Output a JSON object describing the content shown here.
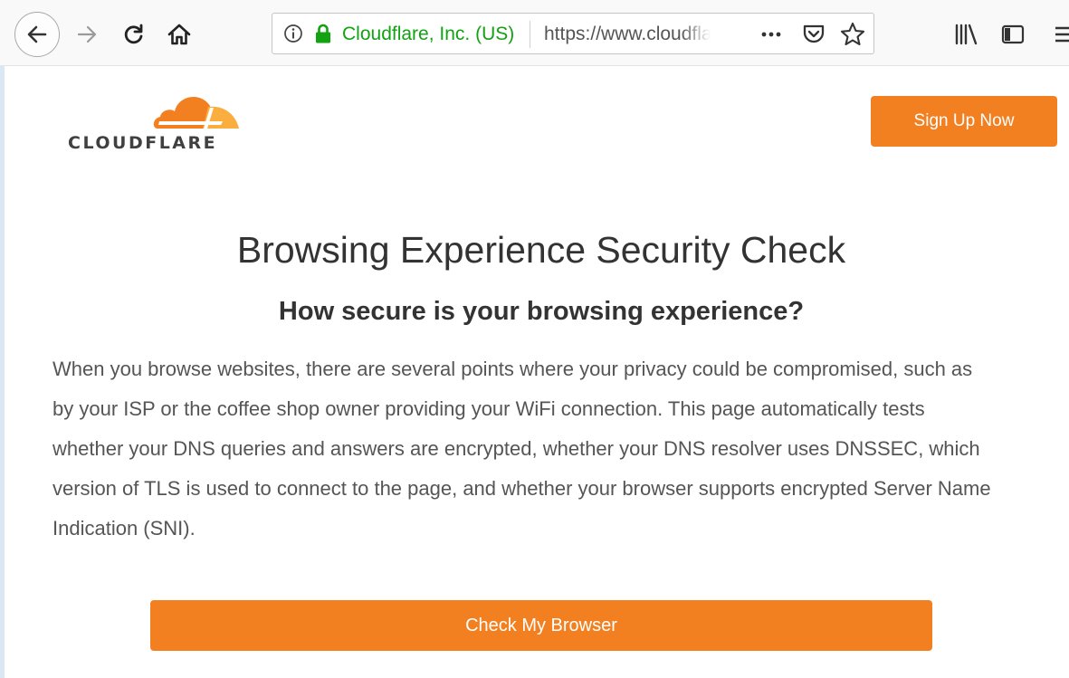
{
  "browser": {
    "site_identity": "Cloudflare, Inc. (US)",
    "url": "https://www.cloudflare.com/ssl/encrypted-sni/",
    "icons": [
      "back-arrow-icon",
      "forward-arrow-icon",
      "reload-icon",
      "home-icon",
      "info-icon",
      "lock-icon",
      "page-actions-icon",
      "pocket-icon",
      "bookmark-star-icon",
      "library-icon",
      "sidebar-icon",
      "hamburger-menu-icon"
    ]
  },
  "header": {
    "logo_text": "CLOUDFLARE",
    "signup_label": "Sign Up Now"
  },
  "main": {
    "title": "Browsing Experience Security Check",
    "subtitle": "How secure is your browsing experience?",
    "description": "When you browse websites, there are several points where your privacy could be compromised, such as by your ISP or the coffee shop owner providing your WiFi connection. This page automatically tests whether your DNS queries and answers are encrypted, whether your DNS resolver uses DNSSEC, which version of TLS is used to connect to the page, and whether your browser supports encrypted Server Name Indication (SNI).",
    "check_button_label": "Check My Browser"
  },
  "colors": {
    "brand_orange": "#f38020",
    "secure_green": "#12a212",
    "text_dark": "#333333",
    "text_body": "#555555"
  }
}
